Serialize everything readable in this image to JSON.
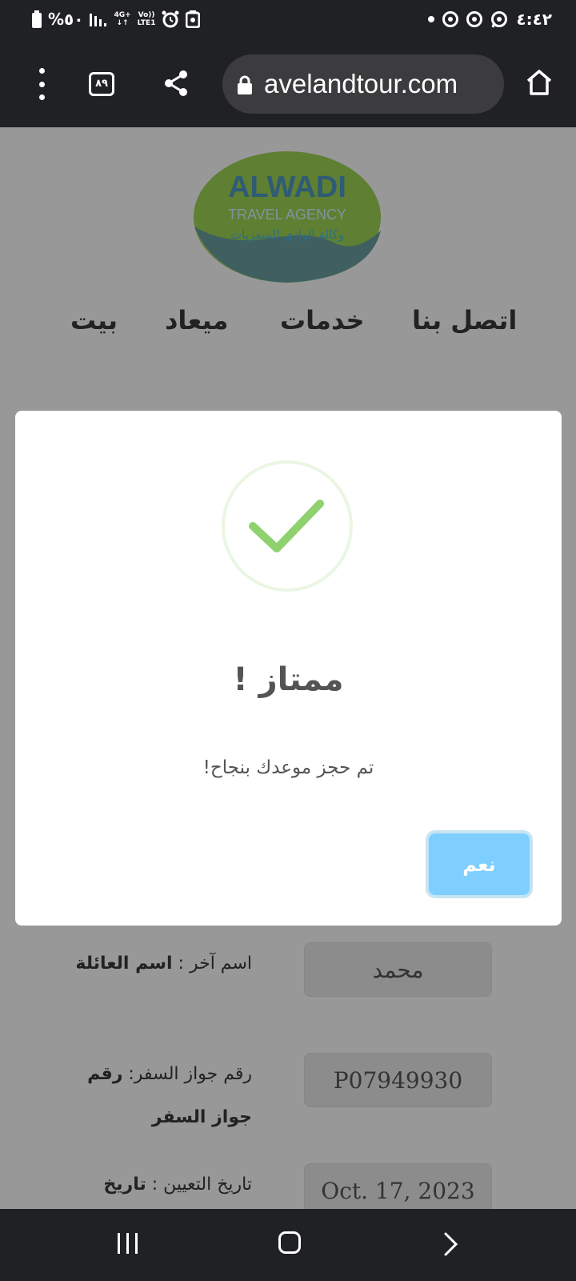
{
  "status_bar": {
    "battery": "%٥٠",
    "signal_top": "4G+",
    "signal_bottom": "↓↑",
    "volte_top": "Vo))",
    "volte_bottom": "LTE1",
    "clock": "٤:٤٢"
  },
  "browser": {
    "tab_count": "٨٩",
    "url": "avelandtour.com"
  },
  "logo": {
    "name": "ALWADI",
    "subtitle": "TRAVEL AGENCY",
    "arabic_name": "وكالة الوادي للسفريات"
  },
  "nav": {
    "contact": "اتصل بنا",
    "services": "خدمات",
    "appointment": "ميعاد",
    "home": "بيت"
  },
  "form": {
    "rows": [
      {
        "label_plain": "اسم آخر : ",
        "label_bold": "اسم العائلة",
        "value": "محمد"
      },
      {
        "label_plain": "رقم جواز السفر: ",
        "label_bold": "رقم جواز السفر",
        "value": "P07949930"
      },
      {
        "label_plain": "تاريخ التعيين : ",
        "label_bold": "تاريخ",
        "value": "Oct. 17, 2023"
      }
    ]
  },
  "modal": {
    "icon": "checkmark-icon",
    "title": "! ممتاز",
    "text": "!تم حجز موعدك بنجاح",
    "confirm_label": "نعم"
  },
  "colors": {
    "success_green": "#8ed16e",
    "confirm_blue": "#7ecfff",
    "overlay": "#989898"
  }
}
